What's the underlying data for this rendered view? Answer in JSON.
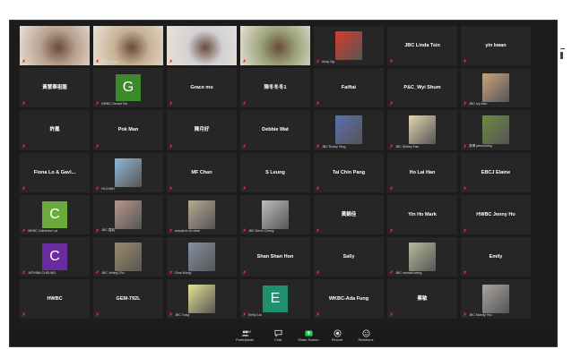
{
  "meeting": {
    "participants": [
      {
        "name": "",
        "label": "",
        "kind": "video",
        "bg": "#b8a08f"
      },
      {
        "name": "",
        "label": "BRT Leung",
        "kind": "video",
        "bg": "#c7b296"
      },
      {
        "name": "",
        "label": "",
        "kind": "video",
        "bg": "#d2d2d4"
      },
      {
        "name": "",
        "label": "",
        "kind": "video",
        "bg": "#9aa37a",
        "active": true
      },
      {
        "name": "",
        "label": "Andy Ng",
        "kind": "photo",
        "bg": "#d83a2a"
      },
      {
        "name": "JBC Linda Tsin",
        "label": "",
        "kind": "name"
      },
      {
        "name": "yin kwan",
        "label": "",
        "kind": "name"
      },
      {
        "name": "黃慧華祖龍",
        "label": "",
        "kind": "name"
      },
      {
        "name": "",
        "label": "HWBC Gerald Tse",
        "kind": "avatar",
        "initial": "G",
        "bg": "#3d8a2c"
      },
      {
        "name": "Grace mo",
        "label": "",
        "kind": "name"
      },
      {
        "name": "陳冬冬冬1",
        "label": "",
        "kind": "name"
      },
      {
        "name": "Faiftai",
        "label": "",
        "kind": "name"
      },
      {
        "name": "P&C_Wyi Shum",
        "label": "",
        "kind": "name"
      },
      {
        "name": "",
        "label": "JBC Ivy Man",
        "kind": "photo",
        "bg": "#c9a37e"
      },
      {
        "name": "許鳳",
        "label": "",
        "kind": "name"
      },
      {
        "name": "Pok Man",
        "label": "",
        "kind": "name"
      },
      {
        "name": "陳月好",
        "label": "",
        "kind": "name"
      },
      {
        "name": "Debbie Wat",
        "label": "",
        "kind": "name"
      },
      {
        "name": "",
        "label": "JBC Rocky Tang",
        "kind": "photo",
        "bg": "#5a6fae"
      },
      {
        "name": "",
        "label": "JBC Shirley Pau",
        "kind": "photo",
        "bg": "#e6d6b0"
      },
      {
        "name": "",
        "label": "張澤 jamcoming",
        "kind": "photo",
        "bg": "#6d8a3e"
      },
      {
        "name": "Fiona Lo & Gavl...",
        "label": "",
        "kind": "name"
      },
      {
        "name": "",
        "label": "HLCHAN",
        "kind": "photo",
        "bg": "#8fb8d6"
      },
      {
        "name": "MF Chan",
        "label": "",
        "kind": "name"
      },
      {
        "name": "S Leung",
        "label": "",
        "kind": "name"
      },
      {
        "name": "Tai Chin Pang",
        "label": "",
        "kind": "name"
      },
      {
        "name": "Ho Lai Han",
        "label": "",
        "kind": "name"
      },
      {
        "name": "EBCJ Elaine",
        "label": "",
        "kind": "name"
      },
      {
        "name": "",
        "label": "WKBC Catherine Lai",
        "kind": "avatar",
        "initial": "C",
        "bg": "#6bab3c"
      },
      {
        "name": "",
        "label": "JBC 嘉凱",
        "kind": "photo",
        "bg": "#b6978a"
      },
      {
        "name": "",
        "label": "wouda le oh chan",
        "kind": "photo",
        "bg": "#b7a892"
      },
      {
        "name": "",
        "label": "JBC Kevin Cheng",
        "kind": "photo",
        "bg": "#bdbdbd"
      },
      {
        "name": "黃錦佳",
        "label": "",
        "kind": "name"
      },
      {
        "name": "Yin Ho Mark",
        "label": "",
        "kind": "name"
      },
      {
        "name": "HWBC Jenny Ho",
        "label": "",
        "kind": "name"
      },
      {
        "name": "",
        "label": "JATHINA CHEUNG",
        "kind": "avatar",
        "initial": "C",
        "bg": "#6a2aa0"
      },
      {
        "name": "",
        "label": "JBC Jerling Zhu",
        "kind": "photo",
        "bg": "#9a8a6a"
      },
      {
        "name": "",
        "label": "Gina Wong",
        "kind": "photo",
        "bg": "#8590a0"
      },
      {
        "name": "Shan Shan Hon",
        "label": "",
        "kind": "name"
      },
      {
        "name": "Sally",
        "label": "",
        "kind": "name"
      },
      {
        "name": "",
        "label": "JBC hannah wang",
        "kind": "photo",
        "bg": "#b8bb9a"
      },
      {
        "name": "Emily",
        "label": "",
        "kind": "name"
      },
      {
        "name": "HWBC",
        "label": "",
        "kind": "name"
      },
      {
        "name": "GEM-792L",
        "label": "",
        "kind": "name"
      },
      {
        "name": "",
        "label": "JBC Tung",
        "kind": "photo",
        "bg": "#e8e290"
      },
      {
        "name": "",
        "label": "Emily Lai",
        "kind": "avatar",
        "initial": "E",
        "bg": "#1f8f6e"
      },
      {
        "name": "WKBC-Ada Fung",
        "label": "",
        "kind": "name"
      },
      {
        "name": "蔡敏",
        "label": "",
        "kind": "name"
      },
      {
        "name": "",
        "label": "JBC Mandy Yeo",
        "kind": "photo",
        "bg": "#aaa4a0"
      }
    ]
  },
  "toolbar": {
    "participants_count": "49",
    "items": [
      {
        "label": "Participants",
        "icon": "participants-icon"
      },
      {
        "label": "Chat",
        "icon": "chat-icon"
      },
      {
        "label": "Share Screen",
        "icon": "share-screen-icon",
        "color": "#1fd15a"
      },
      {
        "label": "Record",
        "icon": "record-icon"
      },
      {
        "label": "Reactions",
        "icon": "reactions-icon"
      }
    ]
  },
  "colors": {
    "window_bg": "#1c1c1c",
    "tile_bg": "#262626",
    "active_speaker": "#7ad13a",
    "muted_icon": "#e02f2f"
  }
}
